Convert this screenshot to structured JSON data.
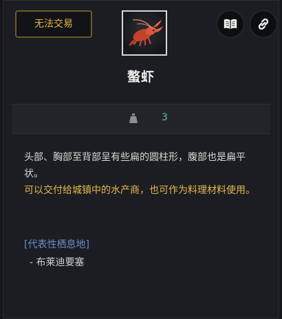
{
  "badge": {
    "label": "无法交易",
    "color": "#e6b348"
  },
  "item": {
    "name": "螯虾",
    "icon": "crayfish-icon",
    "weight": "3"
  },
  "toolbar": {
    "book_icon": "book-icon",
    "link_icon": "link-icon"
  },
  "description": {
    "text": "头部、胸部至背部呈有些扁的圆柱形，腹部也是扁平状。",
    "highlight": "可以交付给城镇中的水产商，也可作为料理材料使用。",
    "highlight_color": "#e7b84c"
  },
  "habitat": {
    "title": "[代表性栖息地]",
    "items": [
      "- 布莱迪要塞"
    ]
  }
}
